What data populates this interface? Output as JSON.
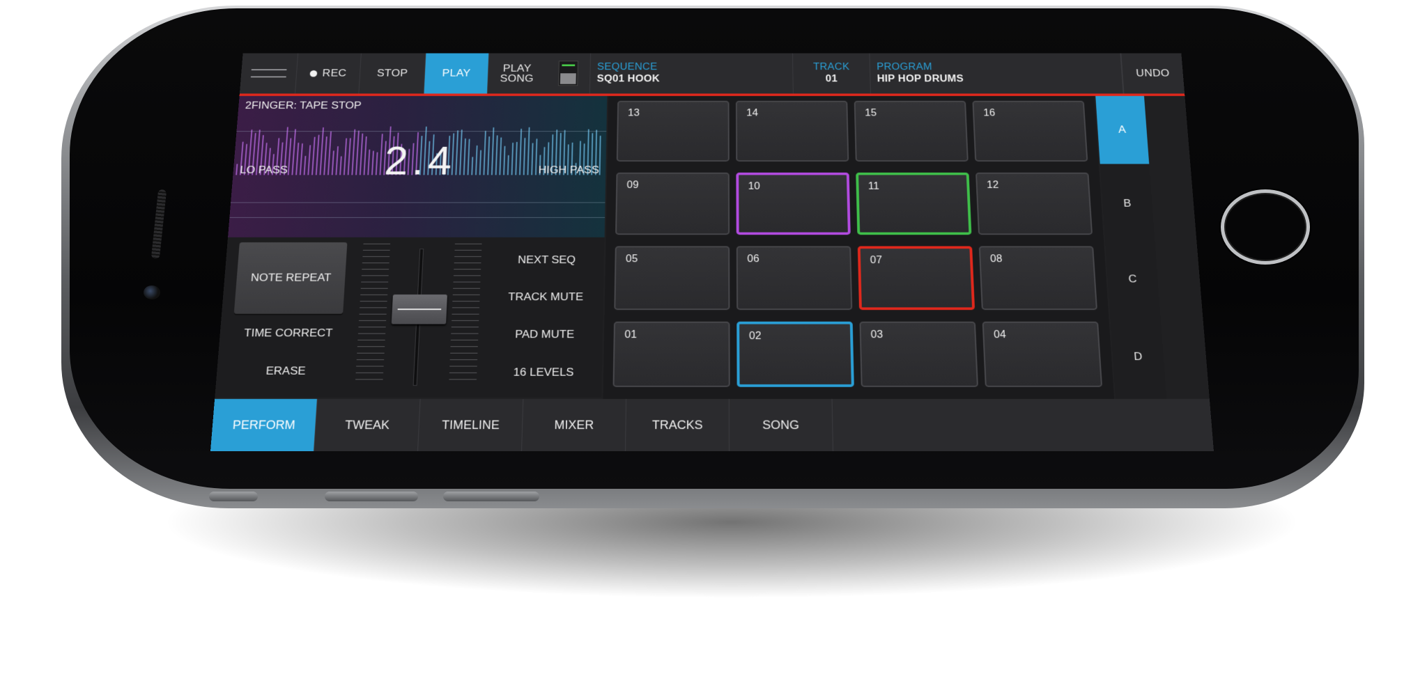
{
  "colors": {
    "accent": "#2a9fd6",
    "rec_line": "#e0281c",
    "pad_purple": "#b24be0",
    "pad_green": "#3fbf4a",
    "pad_red": "#e0281c",
    "pad_blue": "#2a9fd6"
  },
  "topbar": {
    "rec_label": "REC",
    "stop_label": "STOP",
    "play_label": "PLAY",
    "play_song_line1": "PLAY",
    "play_song_line2": "SONG",
    "sequence_label": "SEQUENCE",
    "sequence_value": "SQ01 HOOK",
    "track_label": "TRACK",
    "track_value": "01",
    "program_label": "PROGRAM",
    "program_value": "HIP HOP DRUMS",
    "undo_label": "UNDO"
  },
  "xy": {
    "title": "2FINGER: TAPE STOP",
    "value": "2.4",
    "lo_label": "LO PASS",
    "hi_label": "HIGH PASS"
  },
  "controls": {
    "note_repeat": "NOTE REPEAT",
    "time_correct": "TIME CORRECT",
    "erase": "ERASE",
    "next_seq": "NEXT SEQ",
    "track_mute": "TRACK MUTE",
    "pad_mute": "PAD MUTE",
    "levels": "16 LEVELS"
  },
  "pads": [
    [
      "13",
      "14",
      "15",
      "16"
    ],
    [
      "09",
      "10",
      "11",
      "12"
    ],
    [
      "05",
      "06",
      "07",
      "08"
    ],
    [
      "01",
      "02",
      "03",
      "04"
    ]
  ],
  "banks": [
    "A",
    "B",
    "C",
    "D"
  ],
  "active_bank": "A",
  "tabs": [
    "PERFORM",
    "TWEAK",
    "TIMELINE",
    "MIXER",
    "TRACKS",
    "SONG"
  ],
  "active_tab": "PERFORM"
}
